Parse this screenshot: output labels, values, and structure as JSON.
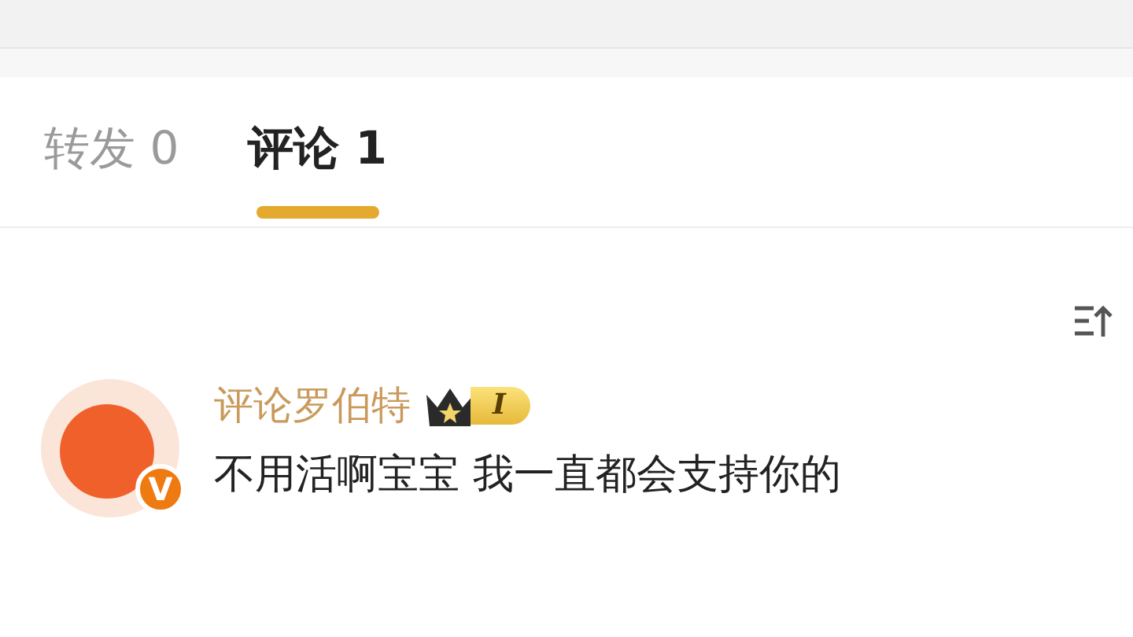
{
  "tabs": [
    {
      "label": "转发 0",
      "selected": false
    },
    {
      "label": "评论 1",
      "selected": true
    }
  ],
  "comment": {
    "author": "评论罗伯特",
    "verified_mark": "V",
    "level": "I",
    "text": "不用活啊宝宝 我一直都会支持你的"
  }
}
